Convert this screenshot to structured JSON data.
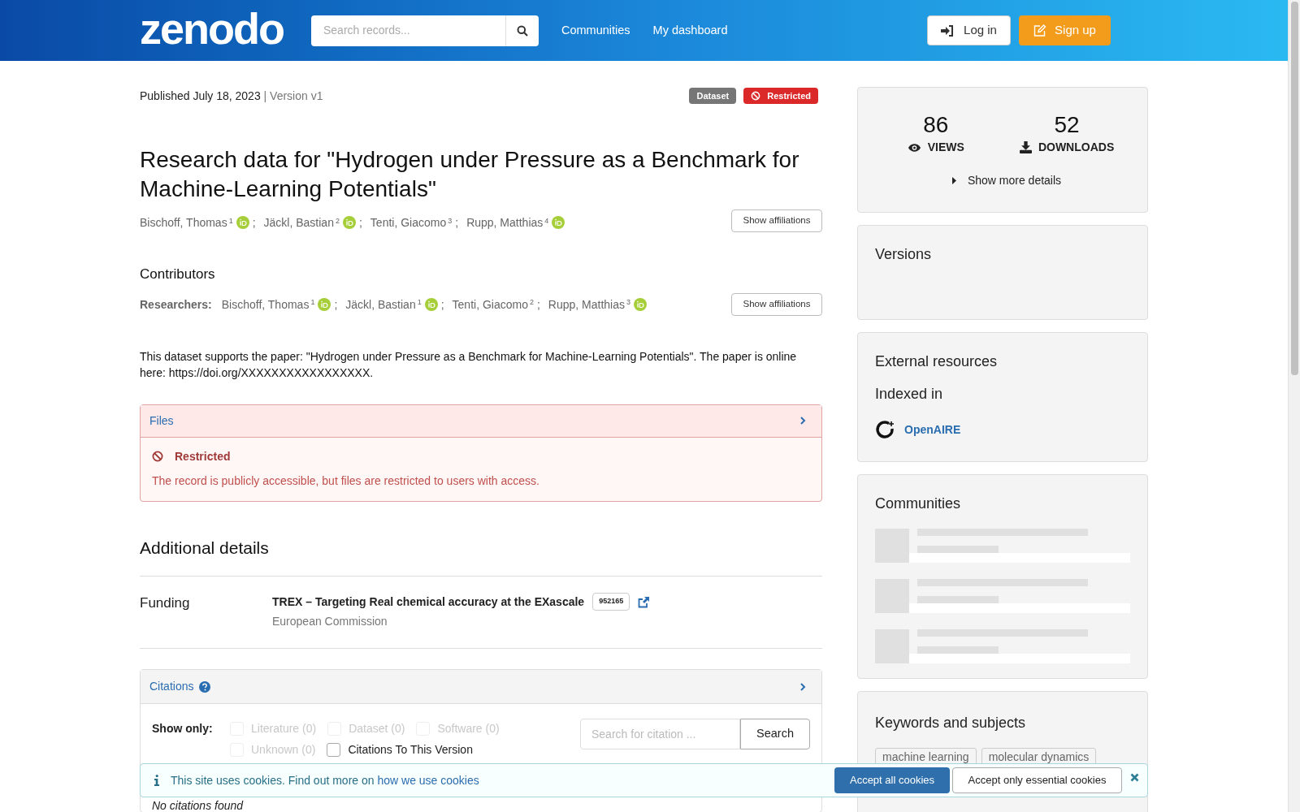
{
  "header": {
    "logo": "zenodo",
    "search": {
      "placeholder": "Search records..."
    },
    "nav": [
      "Communities",
      "My dashboard"
    ],
    "login": "Log in",
    "signup": "Sign up"
  },
  "record": {
    "published": "Published July 18, 2023",
    "version": "| Version v1",
    "badges": [
      {
        "label": "Dataset",
        "kind": "type"
      },
      {
        "label": "Restricted",
        "kind": "access"
      }
    ],
    "title": "Research data for \"Hydrogen under Pressure as a Benchmark for Machine-Learning Potentials\"",
    "separator": ";",
    "creators": [
      {
        "name": "Bischoff, Thomas",
        "aff": "1",
        "orcid": true
      },
      {
        "name": "Jäckl, Bastian",
        "aff": "2",
        "orcid": true
      },
      {
        "name": "Tenti, Giacomo",
        "aff": "3",
        "orcid": false
      },
      {
        "name": "Rupp, Matthias",
        "aff": "4",
        "orcid": true
      }
    ],
    "show_affiliations": "Show affiliations",
    "contributors": {
      "title": "Contributors",
      "role": "Researchers:",
      "show_affiliations": "Show affiliations",
      "people": [
        {
          "name": "Bischoff, Thomas",
          "aff": "1",
          "orcid": true
        },
        {
          "name": "Jäckl, Bastian",
          "aff": "1",
          "orcid": true
        },
        {
          "name": "Tenti, Giacomo",
          "aff": "2",
          "orcid": false
        },
        {
          "name": "Rupp, Matthias",
          "aff": "3",
          "orcid": true
        }
      ]
    },
    "description": "This dataset supports the paper: \"Hydrogen under Pressure as a Benchmark for Machine-Learning Potentials\". The paper is online here: https://doi.org/XXXXXXXXXXXXXXXXX."
  },
  "files": {
    "title": "Files",
    "restricted_title": "Restricted",
    "message": "The record is publicly accessible, but files are restricted to users with access."
  },
  "additional": {
    "title": "Additional details",
    "funding": {
      "label": "Funding",
      "title": "TREX – Targeting Real chemical accuracy at the EXascale",
      "award": "952165",
      "funder": "European Commission"
    }
  },
  "citations": {
    "title": "Citations",
    "show_only": "Show only:",
    "filters": [
      {
        "label": "Literature (0)",
        "checked": false,
        "disabled": true
      },
      {
        "label": "Dataset (0)",
        "checked": false,
        "disabled": true
      },
      {
        "label": "Software (0)",
        "checked": false,
        "disabled": true
      },
      {
        "label": "Unknown (0)",
        "checked": false,
        "disabled": true
      },
      {
        "label": "Citations To This Version",
        "checked": false,
        "disabled": false
      }
    ],
    "search": {
      "placeholder": "Search for citation ..."
    },
    "search_button": "Search",
    "empty": "No citations found"
  },
  "sidebar": {
    "stats": [
      {
        "value": "86",
        "label": "VIEWS",
        "kind": "views"
      },
      {
        "value": "52",
        "label": "DOWNLOADS",
        "kind": "downloads"
      }
    ],
    "show_more": "Show more details",
    "versions": "Versions",
    "external": {
      "title": "External resources",
      "indexed": "Indexed in",
      "link": "OpenAIRE"
    },
    "communities": "Communities",
    "keywords": {
      "title": "Keywords and subjects",
      "tags": [
        "machine learning",
        "molecular dynamics"
      ]
    }
  },
  "cookie": {
    "text": "This site uses cookies. Find out more on ",
    "link": "how we use cookies",
    "accept_all": "Accept all cookies",
    "accept_essential": "Accept only essential cookies"
  }
}
